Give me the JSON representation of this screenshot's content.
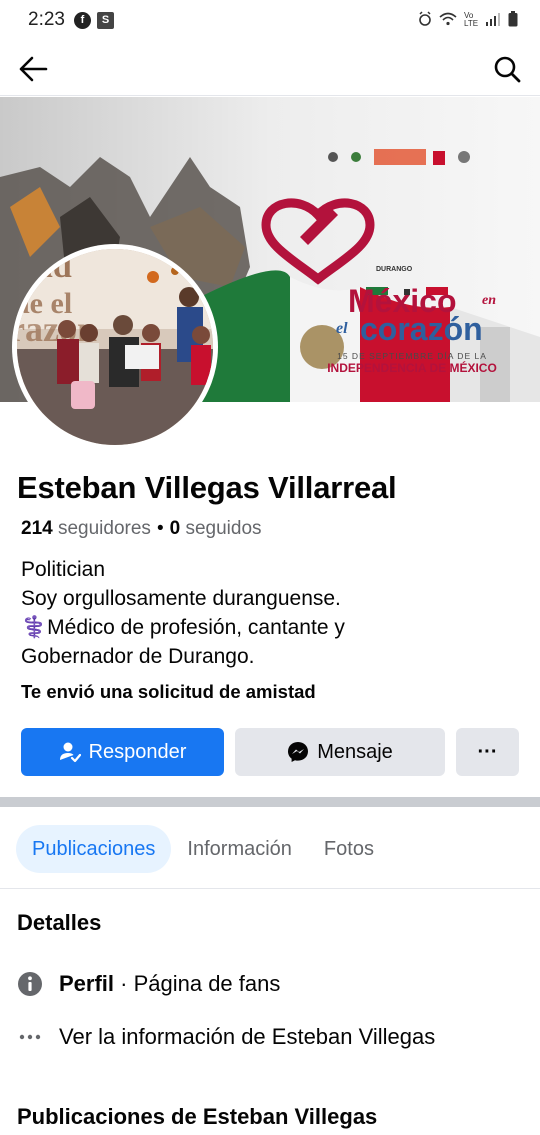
{
  "status_bar": {
    "time": "2:23",
    "left_icons": [
      "facebook-icon",
      "s-app-icon"
    ],
    "right_icons": [
      "alarm-icon",
      "wifi-icon",
      "volte-icon",
      "signal-icon",
      "battery-icon"
    ],
    "volte_text": "Vo LTE"
  },
  "nav": {
    "back_icon": "arrow-left-icon",
    "search_icon": "search-icon"
  },
  "cover": {
    "title_main": "México",
    "title_en": "en",
    "title_el": "el",
    "title_corazon": "corazón",
    "subtitle_date": "15 DE SEPTIEMBRE DÍA DE LA",
    "subtitle_main": "INDEPENDENCIA DE MÉXICO",
    "logo_text": "DURANGO"
  },
  "profile": {
    "name": "Esteban Villegas Villarreal",
    "followers_count": "214",
    "followers_label": "seguidores",
    "separator": "•",
    "following_count": "0",
    "following_label": "seguidos",
    "bio": {
      "line1": "Politician",
      "line2": "Soy orgullosamente duranguense.",
      "line3": "⚕️Médico de profesión, cantante y",
      "line4": "Gobernador de Durango."
    },
    "friend_request_text": "Te envió una solicitud de amistad"
  },
  "actions": {
    "respond_label": "Responder",
    "message_label": "Mensaje",
    "more_label": "···"
  },
  "tabs": [
    {
      "label": "Publicaciones",
      "active": true
    },
    {
      "label": "Información",
      "active": false
    },
    {
      "label": "Fotos",
      "active": false
    }
  ],
  "details": {
    "title": "Detalles",
    "profile_type_bold": "Perfil",
    "profile_type_rest": " · Página de fans",
    "see_info": "Ver la información de Esteban Villegas"
  },
  "posts_title": "Publicaciones de Esteban Villegas",
  "colors": {
    "primary": "#1877f2",
    "secondary_bg": "#e4e6eb",
    "tab_active_bg": "#e7f3ff",
    "text_muted": "#65676b"
  }
}
